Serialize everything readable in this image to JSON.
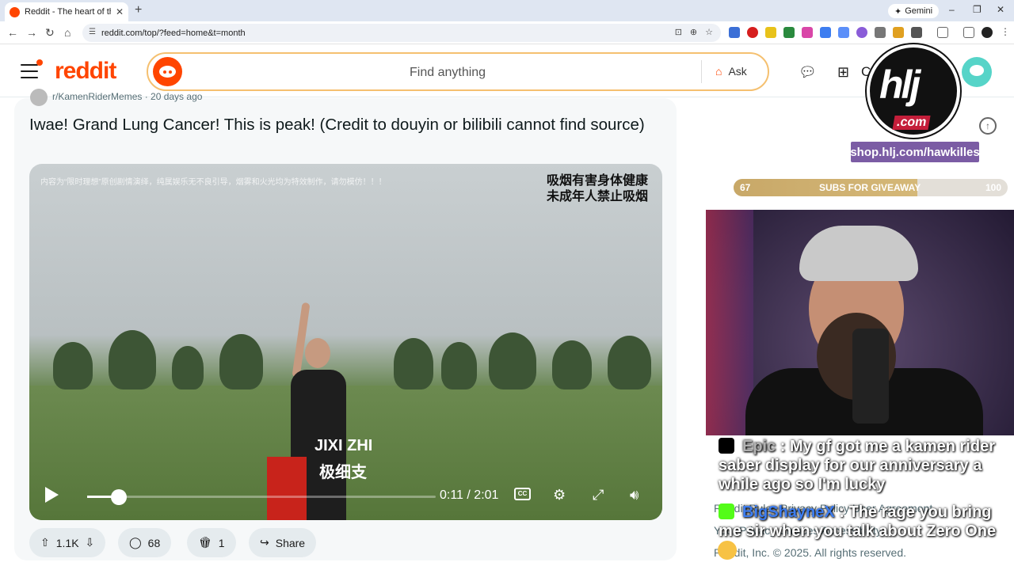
{
  "browser": {
    "tab_title": "Reddit - The heart of the internet",
    "new_tab": "+",
    "gemini_label": "Gemini",
    "url": "reddit.com/top/?feed=home&t=month",
    "window_controls": [
      "–",
      "❐",
      "✕"
    ]
  },
  "header": {
    "logo": "reddit",
    "search_placeholder": "Find anything",
    "ask_label": "Ask",
    "create_letter": "C"
  },
  "post": {
    "meta": "r/KamenRiderMemes · 20 days ago",
    "title": "Iwae! Grand Lung Cancer! This is peak! (Credit to douyin or bilibili cannot find source)",
    "video": {
      "watermark": "内容为“限时理想”原创剧情演绎，纯属娱乐无不良引导，烟雾和火光均为特效制作，请勿模仿！！！",
      "warning_line1": "吸烟有害身体健康",
      "warning_line2": "未成年人禁止吸烟",
      "subtitle_en": "JIXI ZHI",
      "subtitle_cn": "极细支",
      "time": "0:11 / 2:01",
      "progress": 0.09,
      "cc_label": "CC"
    },
    "actions": {
      "votes": "1.1K",
      "comments": "68",
      "awards": "1",
      "share": "Share"
    }
  },
  "sidebar_footer": {
    "line1": "Reddit Rules   Privacy Policy   User Agreement",
    "line2": "Your Privacy Choices   Accessibility",
    "line3": "Reddit, Inc. © 2025. All rights reserved."
  },
  "overlay": {
    "logo_text": "hlj",
    "logo_com": ".com",
    "shop_url": "shop.hlj.com/hawkilles",
    "subs_current": "67",
    "subs_label": "SUBS FOR GIVEAWAY",
    "subs_goal": "100",
    "subs_progress": 0.67,
    "chat": [
      {
        "user": "Epic",
        "text": " : My gf got me a kamen rider saber display for our anniversary a while ago so I'm lucky"
      },
      {
        "user": "BigShayneX",
        "text": " : The rage you bring me sir when you talk about Zero One"
      }
    ]
  },
  "colors": {
    "reddit_orange": "#ff4500",
    "search_border": "#f5c070",
    "shop_purple": "#7b5ca4"
  }
}
